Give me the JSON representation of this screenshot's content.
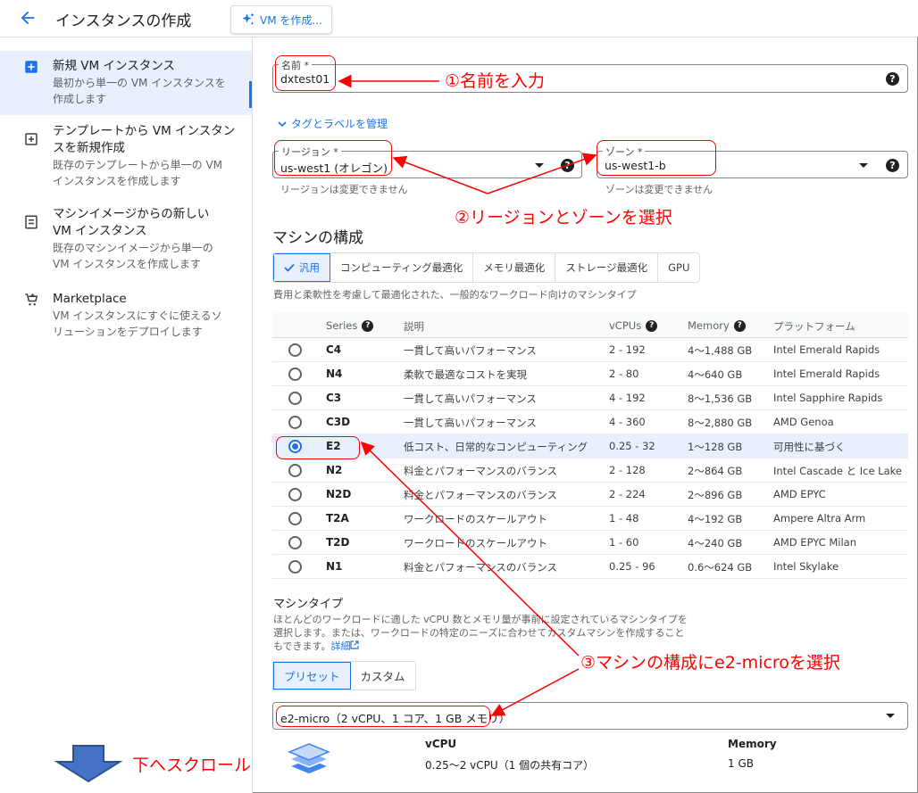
{
  "header": {
    "title": "インスタンスの作成",
    "create_vm_button": "VM を作成..."
  },
  "sidebar": {
    "items": [
      {
        "title": "新規 VM インスタンス",
        "desc": "最初から単一の VM インスタンスを作成します",
        "icon": "add-box-icon"
      },
      {
        "title": "テンプレートから VM インスタンスを新規作成",
        "desc": "既存のテンプレートから単一の VM インスタンスを作成します",
        "icon": "template-icon"
      },
      {
        "title": "マシンイメージからの新しい VM インスタンス",
        "desc": "既存のマシンイメージから単一の VM インスタンスを作成します",
        "icon": "machine-image-icon"
      },
      {
        "title": "Marketplace",
        "desc": "VM インスタンスにすぐに使えるソリューションをデプロイします",
        "icon": "cart-icon"
      }
    ],
    "scroll_note": "下へスクロール"
  },
  "form": {
    "name_label": "名前 *",
    "name_value": "dxtest01",
    "tags_link": "タグとラベルを管理",
    "region_label": "リージョン *",
    "region_value": "us-west1 (オレゴン)",
    "region_hint": "リージョンは変更できません",
    "zone_label": "ゾーン *",
    "zone_value": "us-west1-b",
    "zone_hint": "ゾーンは変更できません"
  },
  "machine_config": {
    "title": "マシンの構成",
    "tabs": [
      "汎用",
      "コンピューティング最適化",
      "メモリ最適化",
      "ストレージ最適化",
      "GPU"
    ],
    "active_tab": "汎用",
    "tabs_desc": "費用と柔軟性を考慮して最適化された、一般的なワークロード向けのマシンタイプ",
    "columns": [
      "Series",
      "説明",
      "vCPUs",
      "Memory",
      "プラットフォーム"
    ],
    "rows": [
      {
        "series": "C4",
        "desc": "一貫して高いパフォーマンス",
        "vcpus": "2 - 192",
        "memory": "4～1,488 GB",
        "platform": "Intel Emerald Rapids",
        "selected": false
      },
      {
        "series": "N4",
        "desc": "柔軟で最適なコストを実現",
        "vcpus": "2 - 80",
        "memory": "4～640 GB",
        "platform": "Intel Emerald Rapids",
        "selected": false
      },
      {
        "series": "C3",
        "desc": "一貫して高いパフォーマンス",
        "vcpus": "4 - 192",
        "memory": "8～1,536 GB",
        "platform": "Intel Sapphire Rapids",
        "selected": false
      },
      {
        "series": "C3D",
        "desc": "一貫して高いパフォーマンス",
        "vcpus": "4 - 360",
        "memory": "8～2,880 GB",
        "platform": "AMD Genoa",
        "selected": false
      },
      {
        "series": "E2",
        "desc": "低コスト、日常的なコンピューティング",
        "vcpus": "0.25 - 32",
        "memory": "1～128 GB",
        "platform": "可用性に基づく",
        "selected": true
      },
      {
        "series": "N2",
        "desc": "料金とパフォーマンスのバランス",
        "vcpus": "2 - 128",
        "memory": "2～864 GB",
        "platform": "Intel Cascade と Ice Lake",
        "selected": false
      },
      {
        "series": "N2D",
        "desc": "料金とパフォーマンスのバランス",
        "vcpus": "2 - 224",
        "memory": "2～896 GB",
        "platform": "AMD EPYC",
        "selected": false
      },
      {
        "series": "T2A",
        "desc": "ワークロードのスケールアウト",
        "vcpus": "1 - 48",
        "memory": "4～192 GB",
        "platform": "Ampere Altra Arm",
        "selected": false
      },
      {
        "series": "T2D",
        "desc": "ワークロードのスケールアウト",
        "vcpus": "1 - 60",
        "memory": "4～240 GB",
        "platform": "AMD EPYC Milan",
        "selected": false
      },
      {
        "series": "N1",
        "desc": "料金とパフォーマンスのバランス",
        "vcpus": "0.25 - 96",
        "memory": "0.6～624 GB",
        "platform": "Intel Skylake",
        "selected": false
      }
    ]
  },
  "machine_type": {
    "title": "マシンタイプ",
    "desc_1": "ほとんどのワークロードに適した vCPU 数とメモリ量が事前に設定されているマシンタイプを",
    "desc_2": "選択します。または、ワークロードの特定のニーズに合わせてカスタムマシンを作成すること",
    "desc_3": "もできます。",
    "desc_link": "詳細",
    "tabs": [
      "プリセット",
      "カスタム"
    ],
    "active_tab": "プリセット",
    "selected": "e2-micro（2 vCPU、1 コア、1 GB メモリ）",
    "vcpu_head": "vCPU",
    "vcpu_value": "0.25～2 vCPU（1 個の共有コア）",
    "memory_head": "Memory",
    "memory_value": "1 GB"
  },
  "annotations": {
    "step1": "①名前を入力",
    "step2": "②リージョンとゾーンを選択",
    "step3": "③マシンの構成にe2-microを選択"
  },
  "colors": {
    "accent": "#1a73e8",
    "annotation": "#ff0000",
    "selected_bg": "#e8f0fe"
  }
}
